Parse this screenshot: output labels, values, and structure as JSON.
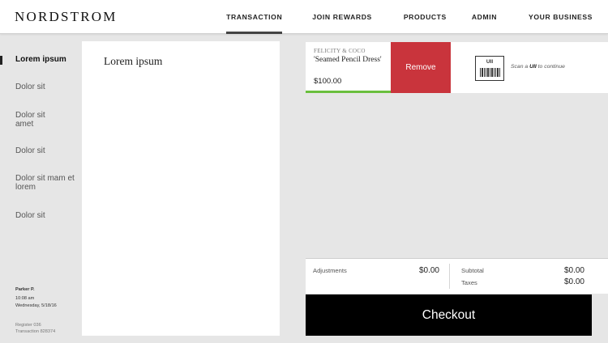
{
  "header": {
    "logo": "NORDSTROM",
    "nav": [
      {
        "label": "TRANSACTION",
        "active": true
      },
      {
        "label": "JOIN REWARDS",
        "active": false
      },
      {
        "label": "PRODUCTS",
        "active": false
      },
      {
        "label": "ADMIN",
        "active": false
      },
      {
        "label": "YOUR BUSINESS",
        "active": false
      }
    ]
  },
  "sidebar": {
    "items": [
      {
        "label": "Lorem ipsum",
        "active": true
      },
      {
        "label": "Dolor sit",
        "active": false
      },
      {
        "label": "Dolor sit amet",
        "active": false
      },
      {
        "label": "Dolor sit",
        "active": false
      },
      {
        "label": "Dolor sit mam et lorem",
        "active": false
      },
      {
        "label": "Dolor sit",
        "active": false
      }
    ],
    "user": {
      "name": "Parker P.",
      "time": "10:08 am",
      "date": "Wednesday, 5/18/16",
      "register": "Register 036",
      "transaction": "Transaction 828374"
    }
  },
  "panel": {
    "title": "Lorem ipsum"
  },
  "item": {
    "brand": "FELICITY & COCO",
    "name": "'Seamed Pencil Dress'",
    "price": "$100.00",
    "remove_label": "Remove",
    "uii_label": "UII",
    "scan_prefix": "Scan a ",
    "scan_bold": "UII",
    "scan_suffix": " to continue"
  },
  "totals": {
    "adjustments_label": "Adjustments",
    "adjustments_value": "$0.00",
    "subtotal_label": "Subtotal",
    "subtotal_value": "$0.00",
    "taxes_label": "Taxes",
    "taxes_value": "$0.00"
  },
  "checkout_label": "Checkout",
  "colors": {
    "remove": "#c9343c",
    "progress": "#6abf3e",
    "checkout": "#000000"
  }
}
